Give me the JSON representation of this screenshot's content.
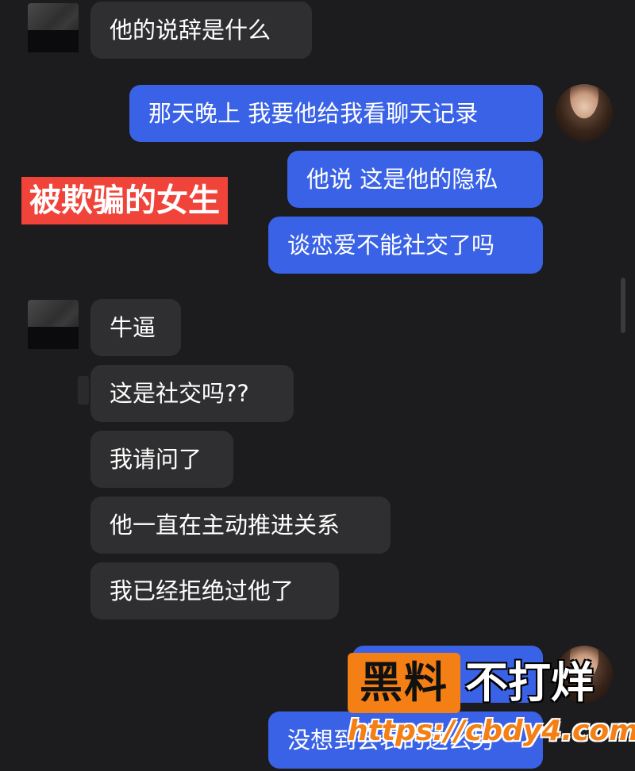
{
  "messages": {
    "m1": "他的说辞是什么",
    "m2": "那天晚上 我要他给我看聊天记录",
    "m3": "他说 这是他的隐私",
    "m4": "谈恋爱不能社交了吗",
    "m5": "牛逼",
    "m6": "这是社交吗??",
    "m7": "我请问了",
    "m8": "他一直在主动推进关系",
    "m9": "我已经拒绝过他了",
    "m10": "",
    "m11": "没想到会表的这么男"
  },
  "tag": "被欺骗的女生",
  "watermark": {
    "box": "黑料",
    "text": "不打烊",
    "url": "https://cbdy4.com"
  },
  "colors": {
    "background": "#1c1c1e",
    "incoming_bubble": "#2f2f31",
    "outgoing_bubble": "#3a62e6",
    "tag": "#f0443a",
    "watermark": "#f47f14"
  }
}
